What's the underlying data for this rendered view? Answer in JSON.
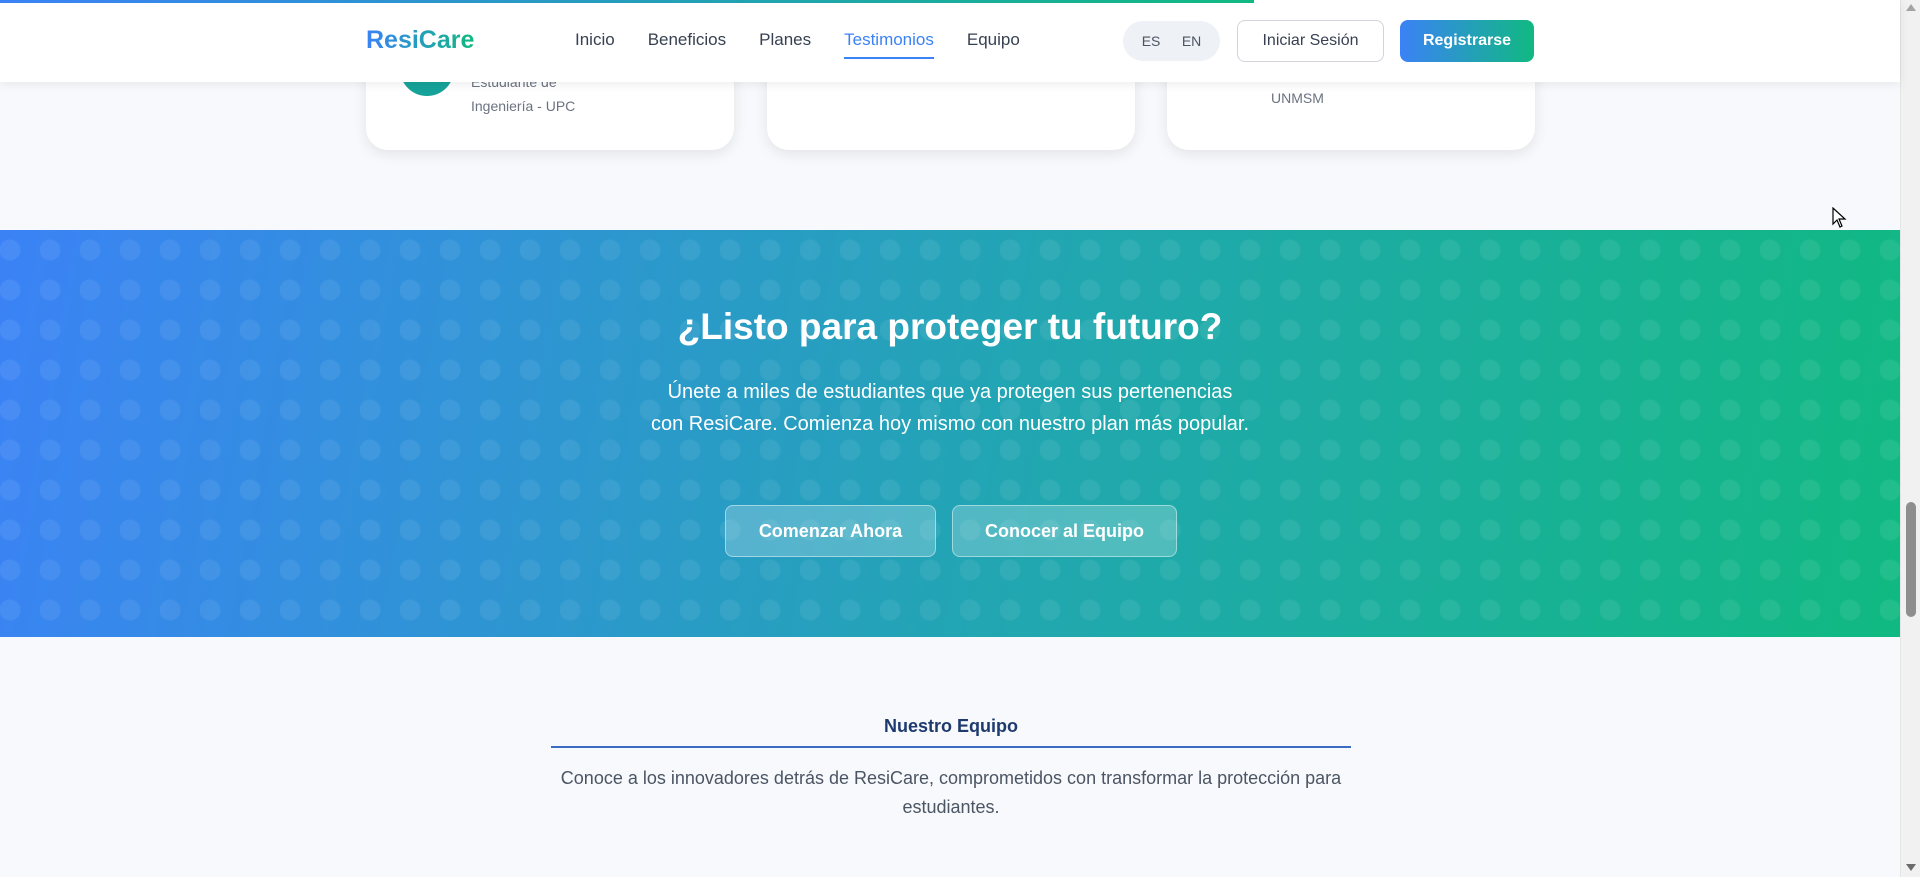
{
  "scroll_progress_percent": 66,
  "header": {
    "logo": "ResiCare",
    "nav": [
      {
        "label": "Inicio",
        "active": false
      },
      {
        "label": "Beneficios",
        "active": false
      },
      {
        "label": "Planes",
        "active": false
      },
      {
        "label": "Testimonios",
        "active": true
      },
      {
        "label": "Equipo",
        "active": false
      }
    ],
    "lang_es": "ES",
    "lang_en": "EN",
    "login_label": "Iniciar Sesión",
    "register_label": "Registrarse"
  },
  "testimonials": {
    "card1_role_line1": "Estudiante de",
    "card1_role_line2": "Ingeniería - UPC",
    "card3_role": "UNMSM"
  },
  "cta": {
    "title": "¿Listo para proteger tu futuro?",
    "subtitle": "Únete a miles de estudiantes que ya protegen sus pertenencias con ResiCare. Comienza hoy mismo con nuestro plan más popular.",
    "primary_button": "Comenzar Ahora",
    "secondary_button": "Conocer al Equipo"
  },
  "team": {
    "title": "Nuestro Equipo",
    "subtitle": "Conoce a los innovadores detrás de ResiCare, comprometidos con transformar la protección para estudiantes."
  },
  "colors": {
    "brand_blue": "#3b82f6",
    "brand_green": "#10b981"
  }
}
